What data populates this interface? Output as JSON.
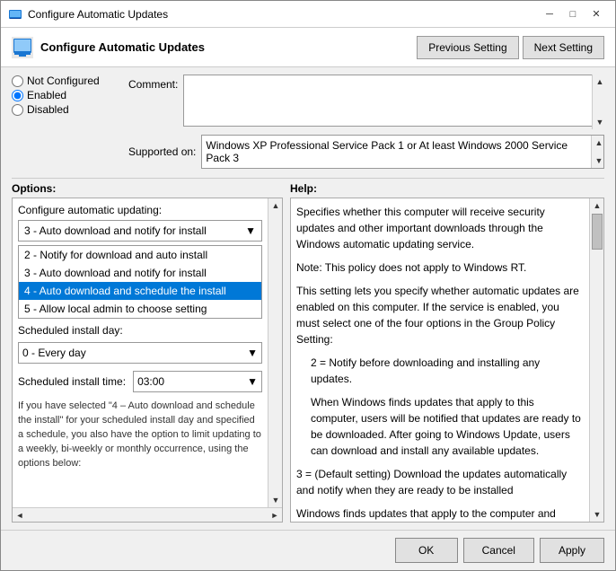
{
  "window": {
    "title": "Configure Automatic Updates",
    "header_title": "Configure Automatic Updates"
  },
  "header_buttons": {
    "previous": "Previous Setting",
    "next": "Next Setting"
  },
  "radio": {
    "not_configured": "Not Configured",
    "enabled": "Enabled",
    "disabled": "Disabled",
    "selected": "enabled"
  },
  "comment": {
    "label": "Comment:"
  },
  "supported": {
    "label": "Supported on:",
    "value": "Windows XP Professional Service Pack 1 or At least Windows 2000 Service Pack 3"
  },
  "options": {
    "header": "Options:",
    "configure_label": "Configure automatic updating:",
    "dropdown_selected": "3 - Auto download and notify for install",
    "dropdown_options": [
      "2 - Notify for download and auto install",
      "3 - Auto download and notify for install",
      "4 - Auto download and schedule the install",
      "5 - Allow local admin to choose setting"
    ],
    "schedule_day_label": "Scheduled install day:",
    "schedule_day_value": "0 - Every day",
    "schedule_time_label": "Scheduled install time:",
    "schedule_time_value": "03:00",
    "body_text": "If you have selected \"4 – Auto download and schedule the install\" for your scheduled install day and specified a schedule, you also have the option to limit updating to a weekly, bi-weekly or monthly occurrence, using the options below:"
  },
  "help": {
    "header": "Help:",
    "paragraphs": [
      "Specifies whether this computer will receive security updates and other important downloads through the Windows automatic updating service.",
      "Note: This policy does not apply to Windows RT.",
      "This setting lets you specify whether automatic updates are enabled on this computer. If the service is enabled, you must select one of the four options in the Group Policy Setting:",
      "2 = Notify before downloading and installing any updates.",
      "When Windows finds updates that apply to this computer, users will be notified that updates are ready to be downloaded. After going to Windows Update, users can download and install any available updates.",
      "3 = (Default setting) Download the updates automatically and notify when they are ready to be installed",
      "Windows finds updates that apply to the computer and"
    ]
  },
  "bottom_buttons": {
    "ok": "OK",
    "cancel": "Cancel",
    "apply": "Apply"
  }
}
